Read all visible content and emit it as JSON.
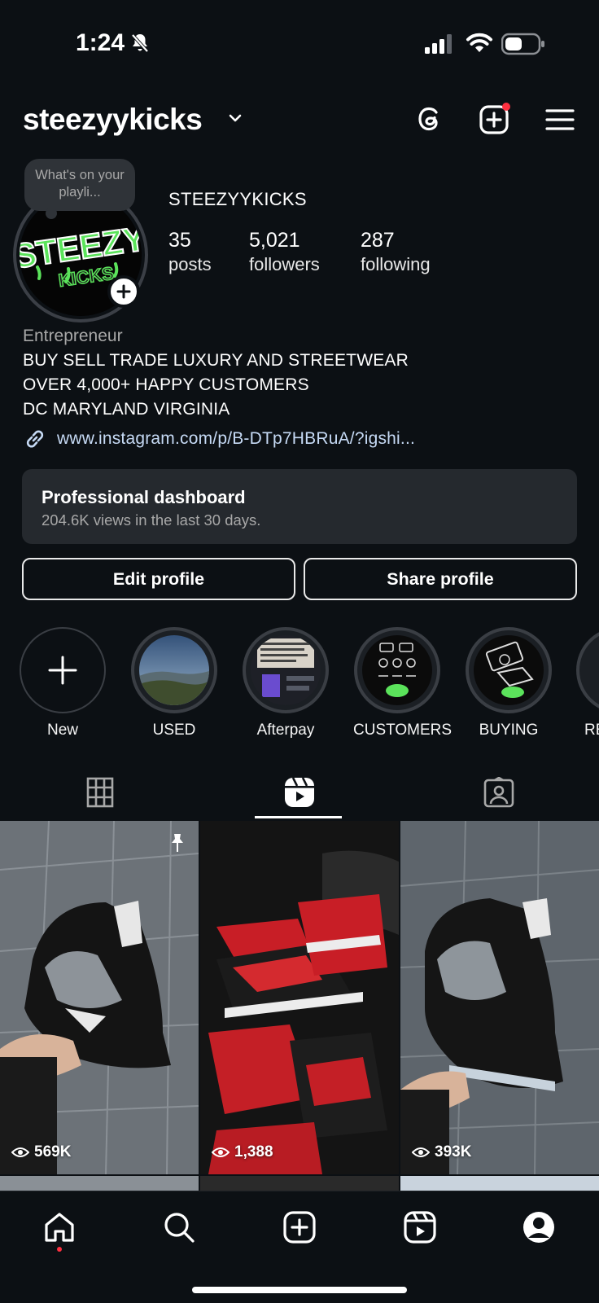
{
  "status_bar": {
    "time": "1:24"
  },
  "header": {
    "username": "steezyykicks"
  },
  "note": {
    "text": "What's on your playli..."
  },
  "avatar": {
    "logo_text_top": "STEEZY",
    "logo_text_bottom": "KICKS"
  },
  "profile": {
    "name": "STEEZYYKICKS",
    "stats": [
      {
        "count": "35",
        "label": "posts"
      },
      {
        "count": "5,021",
        "label": "followers"
      },
      {
        "count": "287",
        "label": "following"
      }
    ],
    "category": "Entrepreneur",
    "bio_lines": [
      "BUY SELL TRADE LUXURY AND STREETWEAR",
      "OVER 4,000+ HAPPY CUSTOMERS",
      "DC MARYLAND VIRGINIA"
    ],
    "link": "www.instagram.com/p/B-DTp7HBRuA/?igshi..."
  },
  "dashboard": {
    "title": "Professional dashboard",
    "subtitle": "204.6K views in the last 30 days."
  },
  "buttons": {
    "edit": "Edit profile",
    "share": "Share profile"
  },
  "highlights": [
    {
      "label": "New"
    },
    {
      "label": "USED"
    },
    {
      "label": "Afterpay"
    },
    {
      "label": "CUSTOMERS"
    },
    {
      "label": "BUYING"
    },
    {
      "label": "RE"
    }
  ],
  "tabs": [
    "grid-icon",
    "reels-icon",
    "tagged-icon"
  ],
  "posts": [
    {
      "views": "569K",
      "pinned": true
    },
    {
      "views": "1,388",
      "pinned": false
    },
    {
      "views": "393K",
      "pinned": false
    }
  ],
  "bottom_nav": [
    "home-icon",
    "search-icon",
    "create-icon",
    "reels-icon",
    "profile-icon"
  ],
  "colors": {
    "background": "#0c1014",
    "link": "#c6daf5",
    "notification": "#ff3040",
    "logo_green": "#5be35b"
  }
}
